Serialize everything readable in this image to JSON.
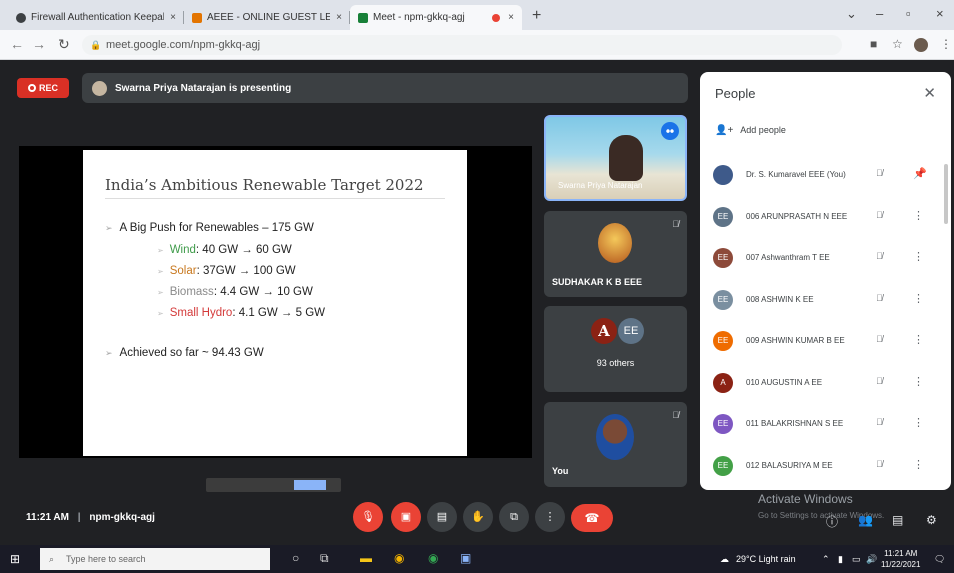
{
  "browser": {
    "tabs": [
      {
        "title": "Firewall Authentication Keepali...",
        "close": "×",
        "color": "#3c4043"
      },
      {
        "title": "AEEE - ONLINE GUEST LECTURE",
        "close": "×",
        "color": "#e37400"
      },
      {
        "title": "Meet - npm-gkkq-agj",
        "close": "×",
        "color": "#188038"
      }
    ],
    "new_tab": "+",
    "url": "meet.google.com/npm-gkkq-agj",
    "window_controls": [
      "⌄",
      "–",
      "▫",
      "×"
    ]
  },
  "meet": {
    "rec_label": "REC",
    "presenting_text": "Swarna Priya Natarajan is presenting",
    "slide": {
      "title": "India’s Ambitious Renewable Target 2022",
      "bullet1": "A Big Push for Renewables – 175 GW",
      "subs": [
        {
          "label": "Wind",
          "value": ": 40 GW → 60 GW",
          "color": "#3f9b4a"
        },
        {
          "label": "Solar",
          "value": ": 37GW → 100 GW",
          "color": "#c8781e"
        },
        {
          "label": "Biomass",
          "value": ": 4.4 GW → 10 GW",
          "color": "#8a8a8a"
        },
        {
          "label": "Small Hydro",
          "value": ": 4.1 GW → 5 GW",
          "color": "#d43a3a"
        }
      ],
      "bullet2": "Achieved so far ~ 94.43 GW"
    },
    "tiles": {
      "presenter_name": "Swarna Priya Natarajan",
      "tile2_name": "SUDHAKAR K B EEE",
      "others_avatars": [
        "A",
        "EE"
      ],
      "others_label": "93 others",
      "you_label": "You"
    },
    "people": {
      "title": "People",
      "add_people": "Add people",
      "participants": [
        {
          "name": "Dr. S. Kumaravel EEE (You)",
          "avatar": "",
          "color": "#3e5a8a"
        },
        {
          "name": "006 ARUNPRASATH N EEE",
          "avatar": "EE",
          "color": "#5e7387"
        },
        {
          "name": "007 Ashwanthram T EE",
          "avatar": "EE",
          "color": "#8d4a3a"
        },
        {
          "name": "008 ASHWIN K EE",
          "avatar": "EE",
          "color": "#7a8fa0"
        },
        {
          "name": "009 ASHWIN KUMAR B EE",
          "avatar": "EE",
          "color": "#ef6c00"
        },
        {
          "name": "010 AUGUSTIN A EE",
          "avatar": "A",
          "color": "#8b2214"
        },
        {
          "name": "011 BALAKRISHNAN S EE",
          "avatar": "EE",
          "color": "#7e57c2"
        },
        {
          "name": "012 BALASURIYA M EE",
          "avatar": "EE",
          "color": "#43a047"
        }
      ]
    },
    "bottom": {
      "time": "11:21 AM",
      "meeting_code": "npm-gkkq-agj",
      "watermark_title": "Activate Windows",
      "watermark_sub": "Go to Settings to activate Windows."
    }
  },
  "taskbar": {
    "search_placeholder": "Type here to search",
    "weather": "29°C  Light rain",
    "time": "11:21 AM",
    "date": "11/22/2021"
  }
}
